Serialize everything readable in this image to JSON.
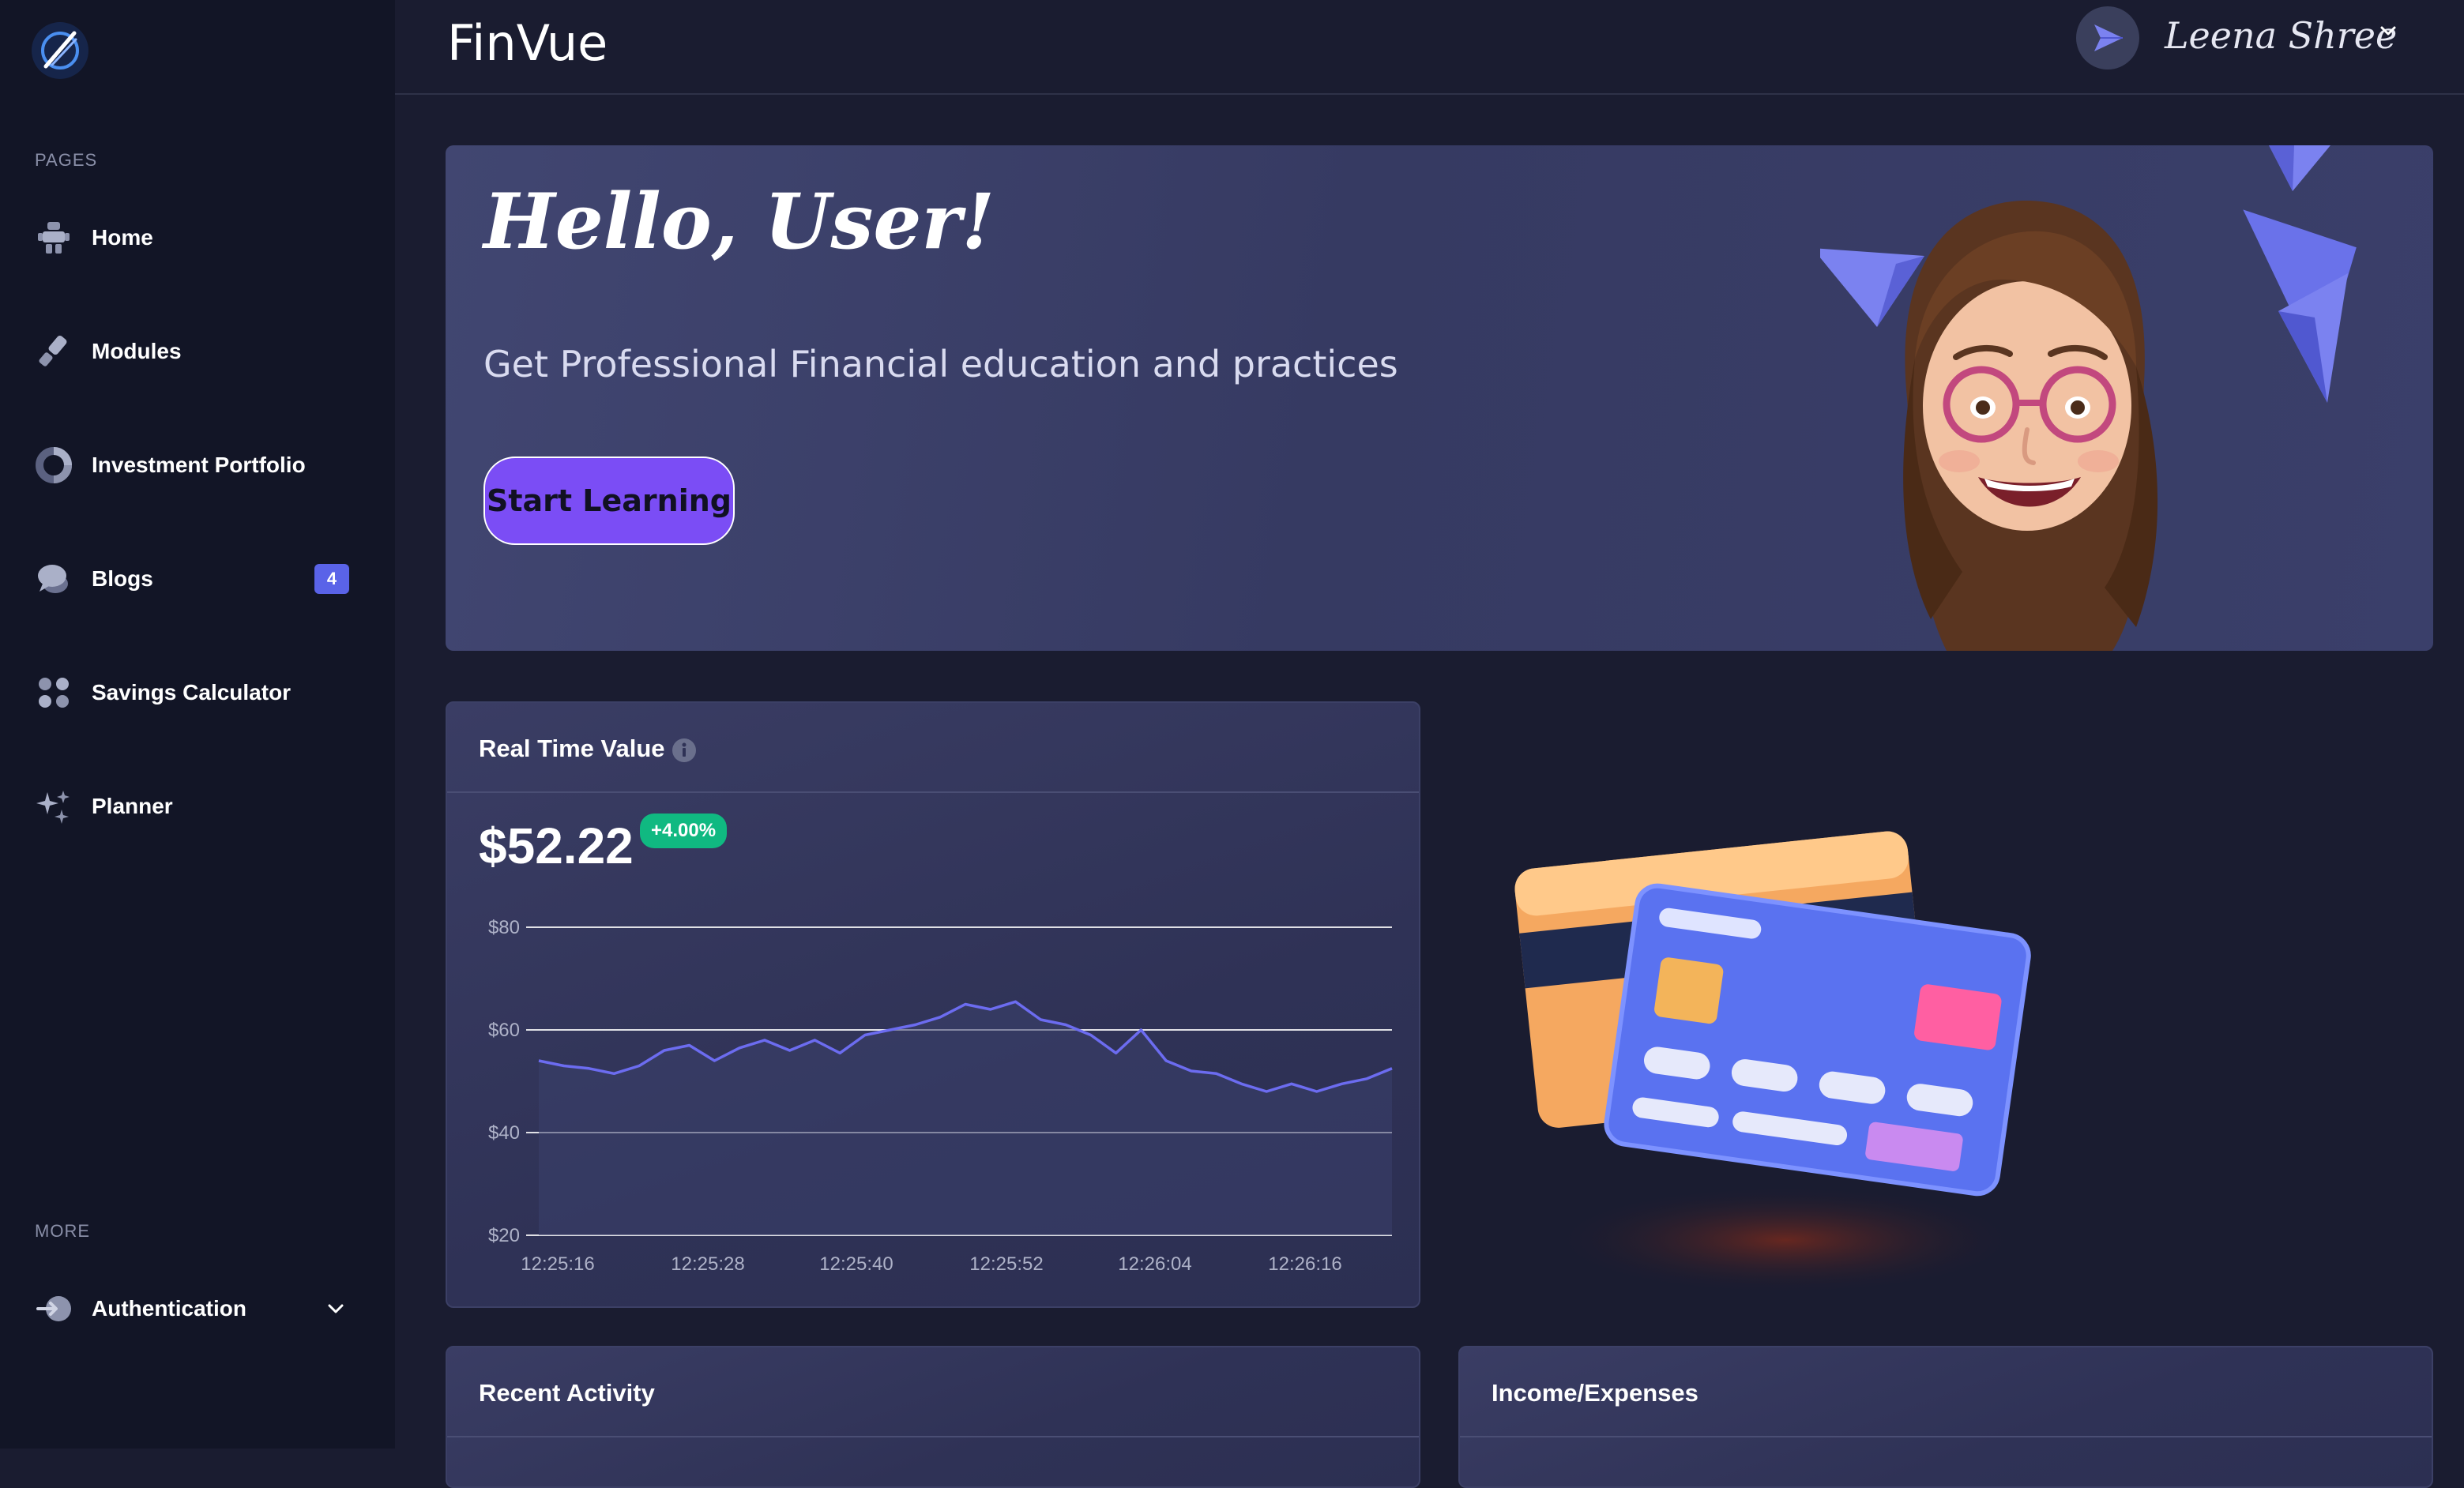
{
  "sidebar": {
    "section_pages": "PAGES",
    "section_more": "MORE",
    "items": [
      {
        "label": "Home",
        "icon": "home-icon"
      },
      {
        "label": "Modules",
        "icon": "modules-icon"
      },
      {
        "label": "Investment Portfolio",
        "icon": "portfolio-icon"
      },
      {
        "label": "Blogs",
        "icon": "blogs-icon",
        "badge": "4"
      },
      {
        "label": "Savings Calculator",
        "icon": "calculator-icon"
      },
      {
        "label": "Planner",
        "icon": "planner-icon"
      }
    ],
    "more_items": [
      {
        "label": "Authentication",
        "icon": "authentication-icon"
      }
    ]
  },
  "header": {
    "title": "FinVue",
    "user_name": "Leena Shree"
  },
  "hero": {
    "greeting": "Hello, User!",
    "subtitle": "Get Professional Financial education and practices",
    "button_label": "Start Learning"
  },
  "real_time": {
    "title": "Real Time Value",
    "value": "$52.22",
    "change": "+4.00%"
  },
  "chart_data": {
    "type": "area",
    "title": "",
    "xlabel": "",
    "ylabel": "",
    "y_ticks": [
      "$20",
      "$40",
      "$60",
      "$80"
    ],
    "ylim": [
      20,
      80
    ],
    "x_tick_labels": [
      "12:25:16",
      "12:25:28",
      "12:25:40",
      "12:25:52",
      "12:26:04",
      "12:26:16"
    ],
    "series": [
      {
        "values": [
          54,
          53,
          52.5,
          51.5,
          53,
          56,
          57,
          54,
          56.5,
          58,
          56,
          58,
          55.5,
          59,
          60,
          61,
          62.5,
          65,
          64,
          65.5,
          62,
          61,
          59,
          55.5,
          60,
          54,
          52,
          51.5,
          49.5,
          48,
          49.5,
          48,
          49.5,
          50.5,
          52.5
        ]
      }
    ],
    "grid": true,
    "colors": {
      "line": "#6c6cf0",
      "fill": "#3b3f6c",
      "grid": "#ffffff"
    }
  },
  "recent_activity": {
    "title": "Recent Activity"
  },
  "income_expenses": {
    "title": "Income/Expenses"
  },
  "colors": {
    "sidebar_bg": "#121526",
    "page_bg": "#1a1c30",
    "accent": "#7b4df5",
    "badge": "#5a63e8",
    "positive": "#10b981"
  }
}
